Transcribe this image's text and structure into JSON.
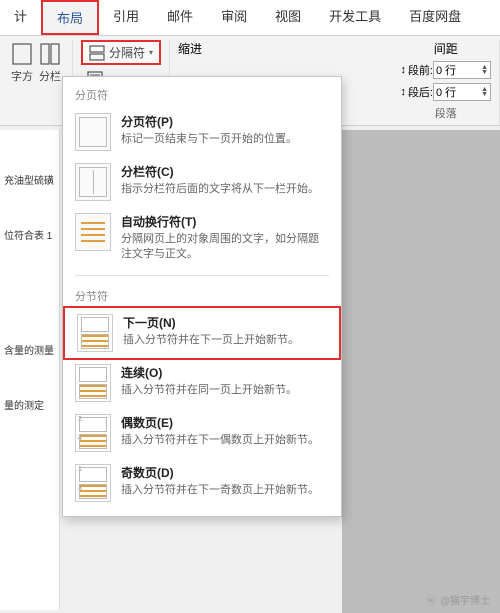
{
  "tabs": {
    "t0": "计",
    "t1": "布局",
    "t2": "引用",
    "t3": "邮件",
    "t4": "审阅",
    "t5": "视图",
    "t6": "开发工具",
    "t7": "百度网盘"
  },
  "toolbar": {
    "direction": "字方",
    "columns": "分栏",
    "breaks": "分隔符",
    "line_numbers": "",
    "indent_label": "缩进",
    "spacing_label": "间距",
    "before_label": "段前:",
    "after_label": "段后:",
    "before_value": "0 行",
    "after_value": "0 行",
    "paragraph_label": "段落"
  },
  "menu": {
    "section1_title": "分页符",
    "items": [
      {
        "title": "分页符(P)",
        "desc": "标记一页结束与下一页开始的位置。"
      },
      {
        "title": "分栏符(C)",
        "desc": "指示分栏符后面的文字将从下一栏开始。"
      },
      {
        "title": "自动换行符(T)",
        "desc": "分隔网页上的对象周围的文字，如分隔题注文字与正文。"
      }
    ],
    "section2_title": "分节符",
    "items2": [
      {
        "title": "下一页(N)",
        "desc": "插入分节符并在下一页上开始新节。"
      },
      {
        "title": "连续(O)",
        "desc": "插入分节符并在同一页上开始新节。"
      },
      {
        "title": "偶数页(E)",
        "desc": "插入分节符并在下一偶数页上开始新节。"
      },
      {
        "title": "奇数页(D)",
        "desc": "插入分节符并在下一奇数页上开始新节。"
      }
    ]
  },
  "doc": {
    "line1": "充油型硫磺",
    "line2": "位符合表 1",
    "line3": "含量的测量",
    "line4": "量的测定"
  },
  "watermark": "@猫宇博士"
}
